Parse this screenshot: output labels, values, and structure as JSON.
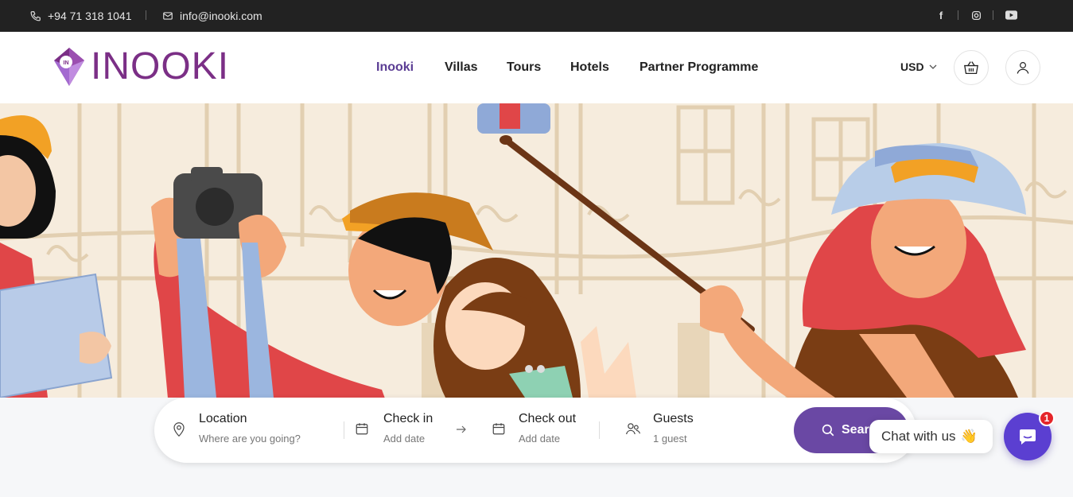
{
  "topbar": {
    "phone": "+94 71 318 1041",
    "email": "info@inooki.com",
    "social": [
      {
        "icon": "facebook-icon",
        "glyph": "f"
      },
      {
        "icon": "instagram-icon",
        "glyph": "◎"
      },
      {
        "icon": "youtube-icon",
        "glyph": "▶"
      }
    ]
  },
  "header": {
    "logo_text": "INOOKI",
    "logo_badge": "IN",
    "nav": [
      {
        "label": "Inooki",
        "active": true
      },
      {
        "label": "Villas",
        "active": false
      },
      {
        "label": "Tours",
        "active": false
      },
      {
        "label": "Hotels",
        "active": false
      },
      {
        "label": "Partner Programme",
        "active": false
      }
    ],
    "currency": "USD"
  },
  "search": {
    "location_label": "Location",
    "location_placeholder": "Where are you going?",
    "checkin_label": "Check in",
    "checkin_value": "Add date",
    "checkout_label": "Check out",
    "checkout_value": "Add date",
    "guests_label": "Guests",
    "guests_value": "1 guest",
    "button_label": "Search"
  },
  "chat": {
    "bubble_text": "Chat with us",
    "bubble_emoji": "👋",
    "badge_count": "1"
  },
  "colors": {
    "brand": "#7b2f86",
    "accent": "#6a48a4",
    "chat": "#5b3fd1",
    "hero_bg": "#f6ecdd"
  }
}
